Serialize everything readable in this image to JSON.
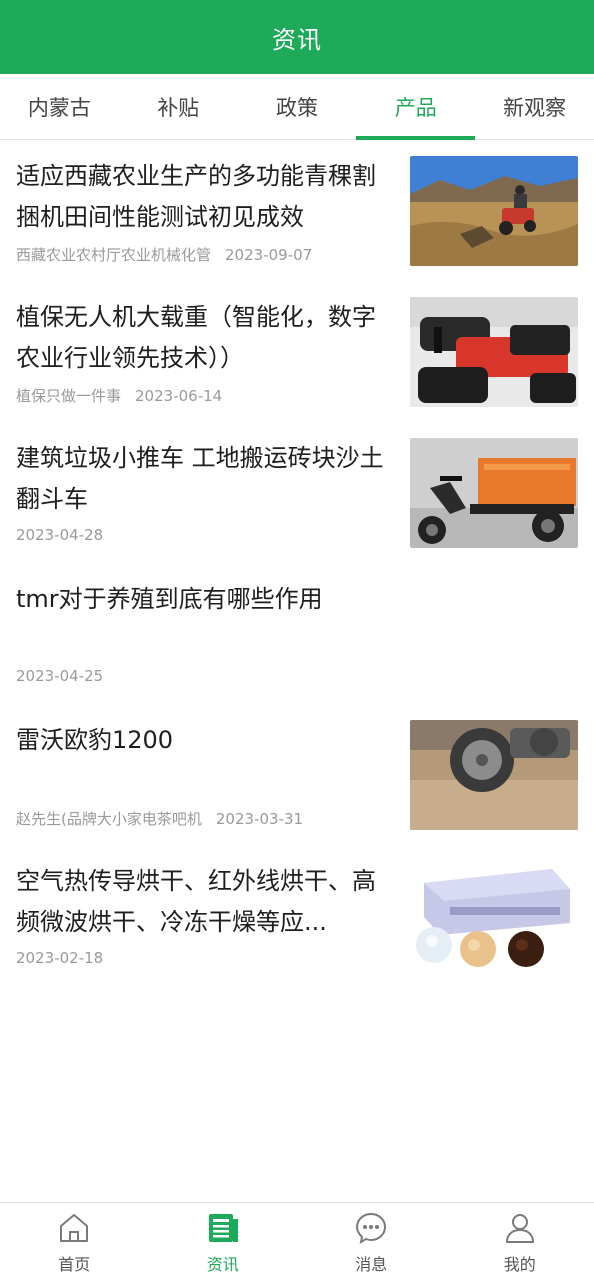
{
  "header": {
    "title": "资讯"
  },
  "tabs": [
    {
      "label": "内蒙古",
      "active": false
    },
    {
      "label": "补贴",
      "active": false
    },
    {
      "label": "政策",
      "active": false
    },
    {
      "label": "产品",
      "active": true
    },
    {
      "label": "新观察",
      "active": false
    }
  ],
  "news": [
    {
      "title": "适应西藏农业生产的多功能青稞割捆机田间性能测试初见成效",
      "source": "西藏农业农村厅农业机械化管",
      "date": "2023-09-07",
      "image": "tractor-field-photo"
    },
    {
      "title": "植保无人机大载重（智能化，数字农业行业领先技术））",
      "source": "植保只做一件事",
      "date": "2023-06-14",
      "image": "red-machine-photo"
    },
    {
      "title": "建筑垃圾小推车 工地搬运砖块沙土翻斗车",
      "source": "",
      "date": "2023-04-28",
      "image": "orange-dump-tricycle-photo"
    },
    {
      "title": "tmr对于养殖到底有哪些作用",
      "source": "",
      "date": "2023-04-25",
      "image": ""
    },
    {
      "title": "雷沃欧豹1200",
      "source": "赵先生(品牌大小家电茶吧机",
      "date": "2023-03-31",
      "image": "tractor-wheel-photo"
    },
    {
      "title": "空气热传导烘干、红外线烘干、高频微波烘干、冷冻干燥等应...",
      "source": "",
      "date": "2023-02-18",
      "image": "microwave-dryer-photo"
    }
  ],
  "bottom_nav": [
    {
      "label": "首页",
      "icon": "home-icon",
      "active": false
    },
    {
      "label": "资讯",
      "icon": "news-icon",
      "active": true
    },
    {
      "label": "消息",
      "icon": "message-icon",
      "active": false
    },
    {
      "label": "我的",
      "icon": "profile-icon",
      "active": false
    }
  ],
  "colors": {
    "accent": "#1faa5a",
    "meta_text": "#9a9a9a"
  }
}
